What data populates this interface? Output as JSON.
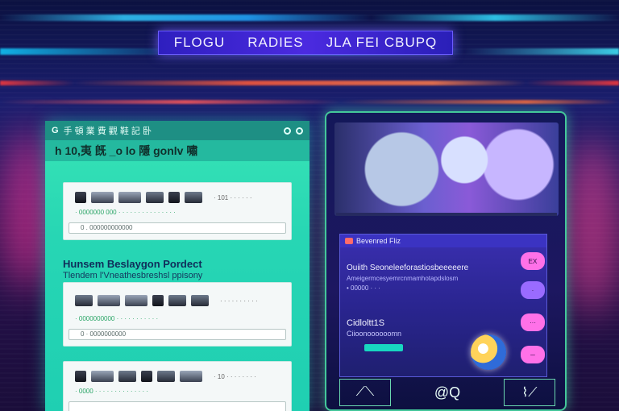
{
  "header": {
    "title_parts": [
      "FLOGU",
      "RADIES",
      "JLA FEI CBUPQ"
    ]
  },
  "left": {
    "topbar_logo": "G",
    "topbar_text": "手 頓 業 費 觀 鞋 記 卧",
    "heading": "h 10,夷 旣 _o lo 隱 gonlv 嘯",
    "card1": {
      "tiny": "· 101 · · · · · ·",
      "meta": "· 0000000 000 · · · · · · · · · · · · · · ·",
      "input": "0 . 000000000000"
    },
    "section_title": "Hunsem Beslaygon Pordect",
    "section_sub": "Tlendem l'Vneathesbreshsl ppisony",
    "card2": {
      "tiny": "· · · · · · · · · ·",
      "meta": "· 0000000000 · · · · · · · · · · ·",
      "input": "0 · 0000000000"
    },
    "card3": {
      "tiny": "· 10 · · · · · · · ·",
      "meta": "· 0000 · · · · · · · · · · · · · ·",
      "input": ""
    }
  },
  "right": {
    "chat_title": "Bevenred Fliz",
    "msg1": "Ouiith Seoneleeforastiosbeeeeere",
    "msg1_sub": "Ameigermcesyemrcnmamhotapdslosm",
    "msg1_dots": "•  00000  ·  ·  ·",
    "msg2": "Cidloltt1S",
    "msg2_sub": "Ciioonoooooomn",
    "buttons": {
      "b1": "EX",
      "b2": "·",
      "b3": "···",
      "b4": "─"
    },
    "bottom": {
      "left": "⟋⟍",
      "mid": "@Q",
      "right": "⌇⟋"
    }
  }
}
